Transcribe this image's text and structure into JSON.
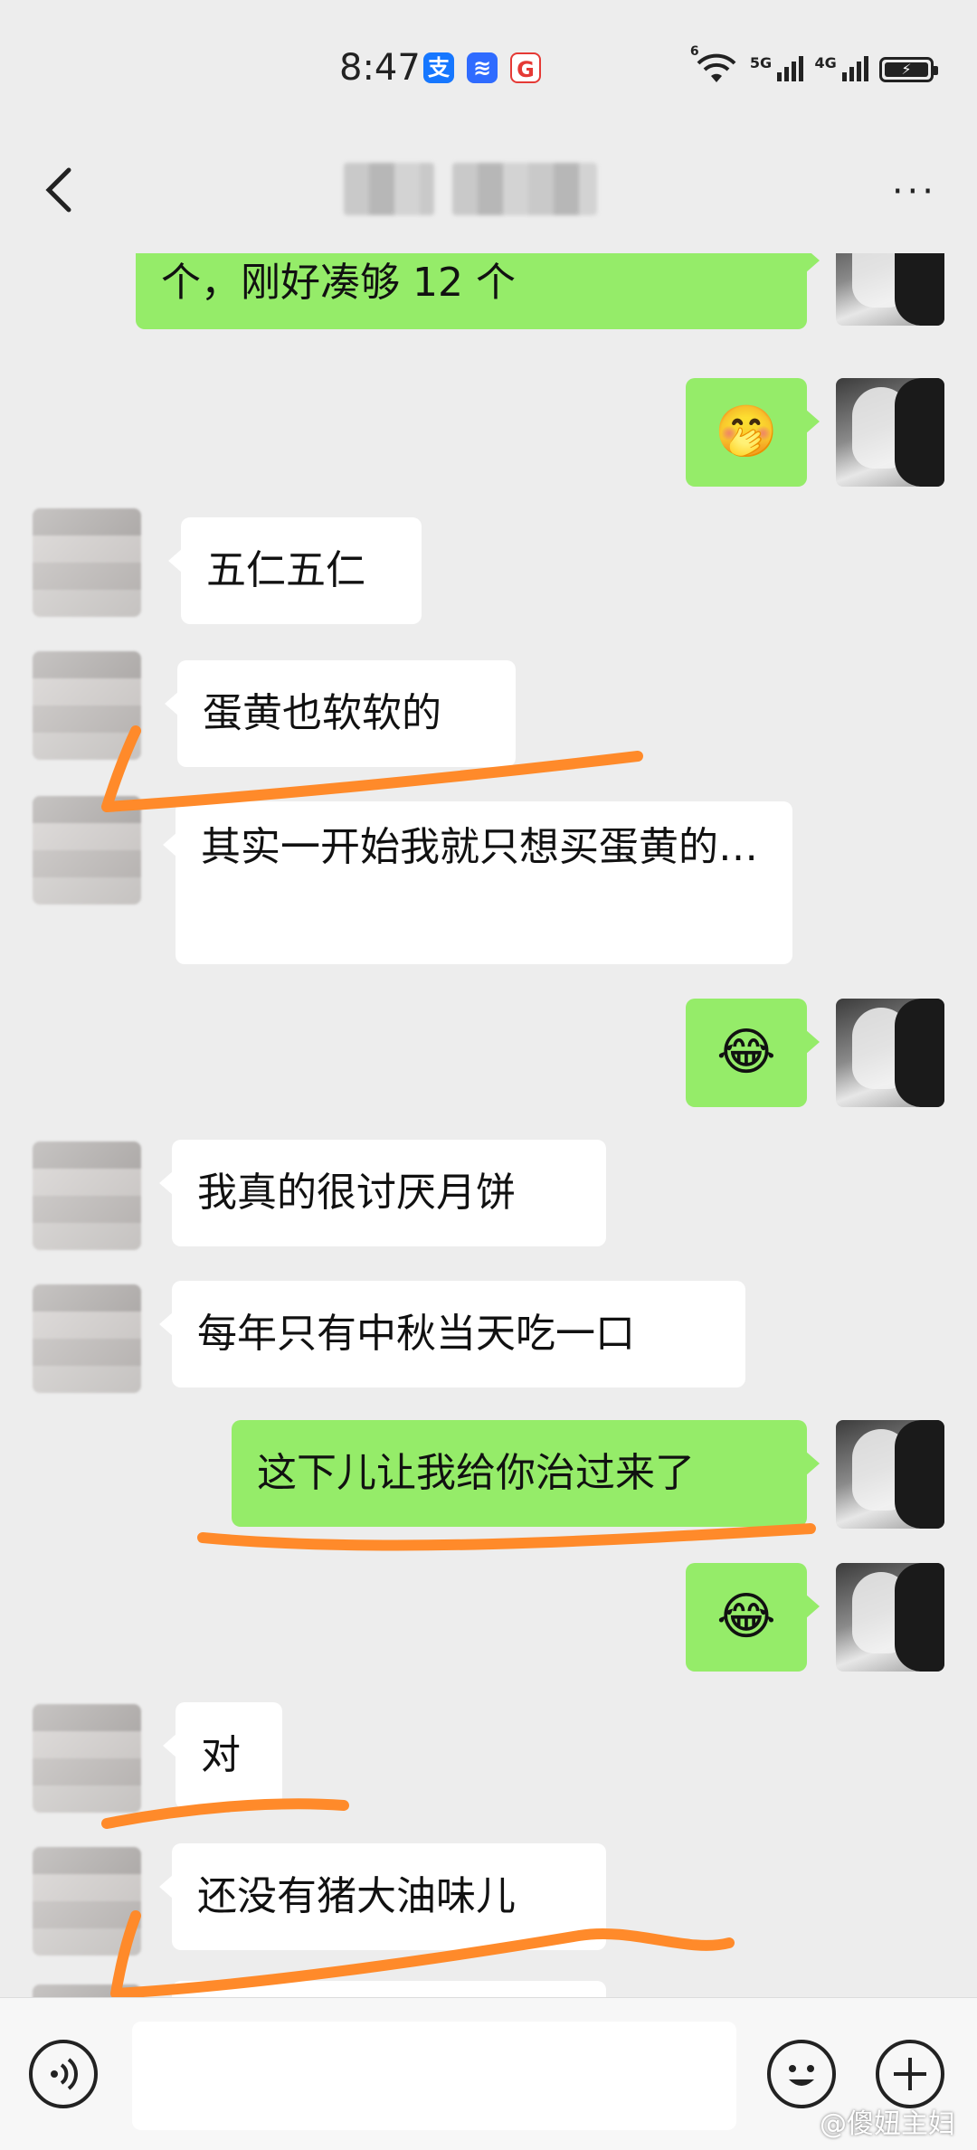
{
  "status_bar": {
    "time": "8:47",
    "apps": [
      {
        "name": "alipay-icon",
        "glyph": "支",
        "color": "#1677ff"
      },
      {
        "name": "voice-app-icon",
        "glyph": "≋",
        "color": "#2f6bff"
      },
      {
        "name": "shield-app-icon",
        "glyph": "G",
        "color": "#e53935"
      }
    ],
    "wifi_label": "6",
    "net1_label": "5G",
    "net2_label": "4G"
  },
  "nav": {
    "more_label": "···"
  },
  "messages": [
    {
      "side": "right",
      "type": "text",
      "text": "个，刚好凑够 12 个"
    },
    {
      "side": "right",
      "type": "emoji",
      "text": "🤭"
    },
    {
      "side": "left",
      "type": "text",
      "text": "五仁五仁"
    },
    {
      "side": "left",
      "type": "text",
      "text": "蛋黄也软软的"
    },
    {
      "side": "left",
      "type": "text",
      "text": "其实一开始我就只想买蛋黄的…"
    },
    {
      "side": "right",
      "type": "emoji",
      "text": "😂"
    },
    {
      "side": "left",
      "type": "text",
      "text": "我真的很讨厌月饼"
    },
    {
      "side": "left",
      "type": "text",
      "text": "每年只有中秋当天吃一口"
    },
    {
      "side": "right",
      "type": "text",
      "text": "这下儿让我给你治过来了"
    },
    {
      "side": "right",
      "type": "emoji",
      "text": "😂"
    },
    {
      "side": "left",
      "type": "text",
      "text": "对"
    },
    {
      "side": "left",
      "type": "text",
      "text": "还没有猪大油味儿"
    }
  ],
  "annotation_color": "#ff8a2a",
  "input_bar": {
    "placeholder": ""
  },
  "watermark": "@傻妞主妇"
}
